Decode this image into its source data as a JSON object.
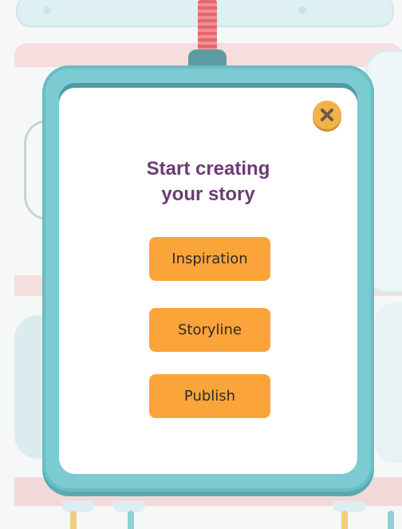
{
  "modal": {
    "title_line1": "Start creating",
    "title_line2": "your story",
    "close_icon": "close-x-icon",
    "buttons": [
      {
        "label": "Inspiration"
      },
      {
        "label": "Storyline"
      },
      {
        "label": "Publish"
      }
    ]
  },
  "colors": {
    "frame": "#7ccbd2",
    "title": "#6b3c73",
    "button": "#fba43a",
    "close": "#f2b24a"
  }
}
